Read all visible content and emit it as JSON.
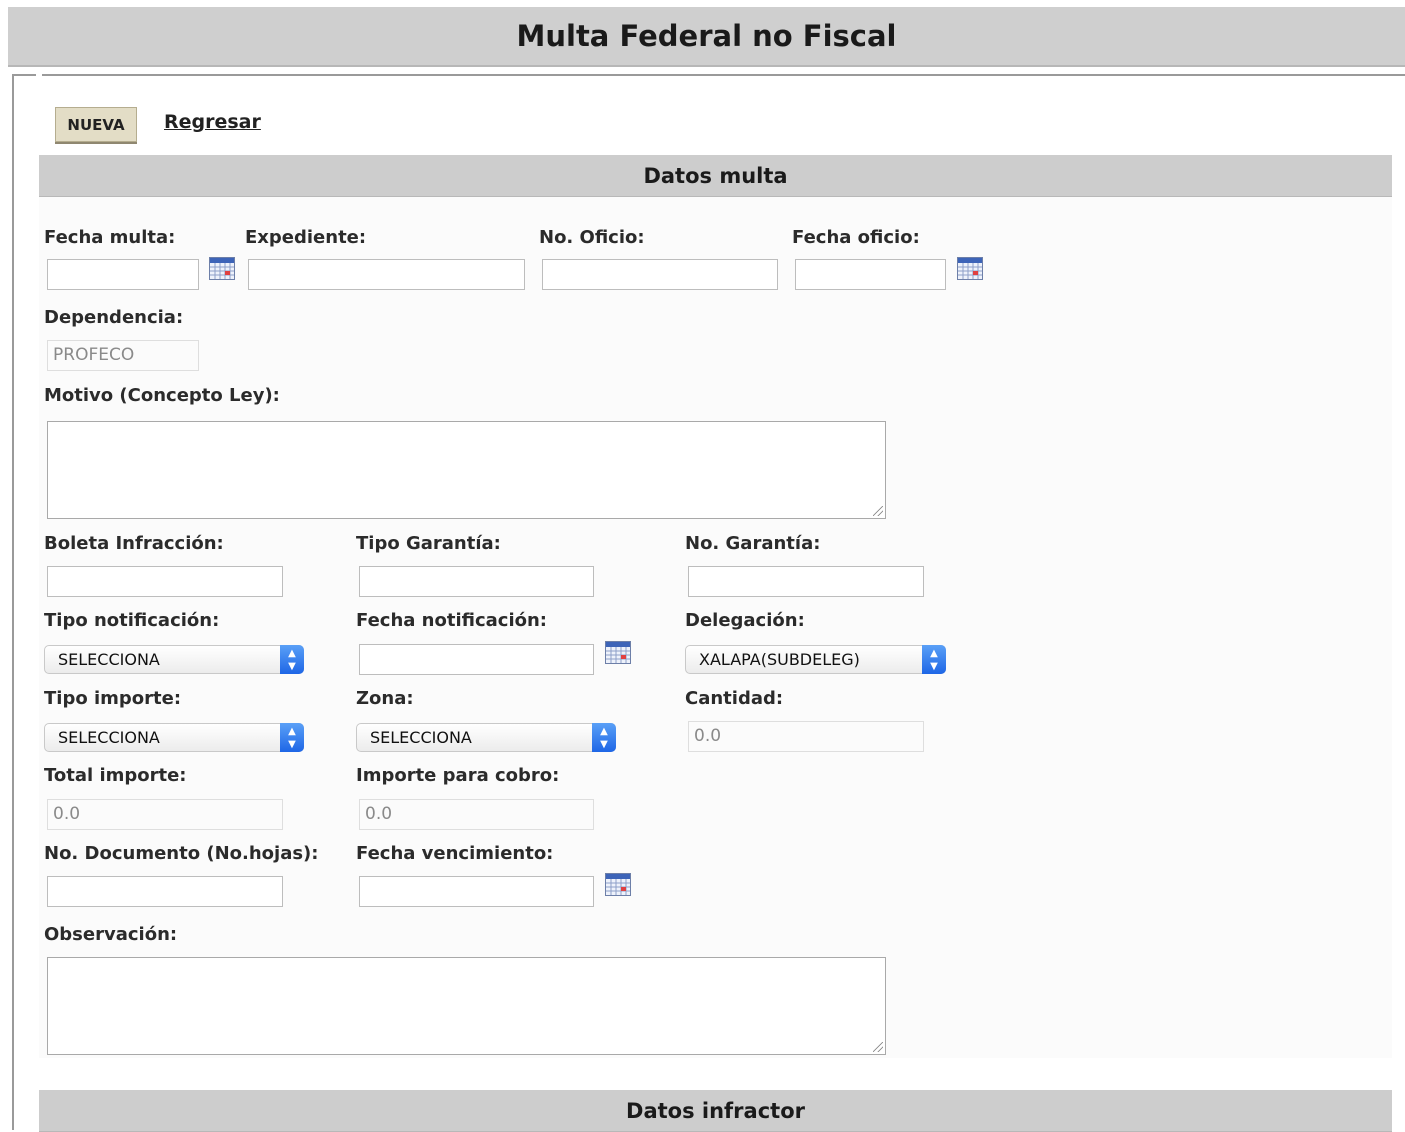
{
  "page": {
    "title": "Multa Federal no Fiscal"
  },
  "toolbar": {
    "nueva_label": "NUEVA",
    "regresar_label": "Regresar"
  },
  "sections": {
    "datos_multa": "Datos multa",
    "datos_infractor": "Datos infractor"
  },
  "fields": {
    "fecha_multa": {
      "label": "Fecha multa:",
      "value": ""
    },
    "expediente": {
      "label": "Expediente:",
      "value": ""
    },
    "no_oficio": {
      "label": "No. Oficio:",
      "value": ""
    },
    "fecha_oficio": {
      "label": "Fecha oficio:",
      "value": ""
    },
    "dependencia": {
      "label": "Dependencia:",
      "value": "PROFECO"
    },
    "motivo": {
      "label": "Motivo (Concepto Ley):",
      "value": ""
    },
    "boleta_infraccion": {
      "label": "Boleta Infracción:",
      "value": ""
    },
    "tipo_garantia": {
      "label": "Tipo Garantía:",
      "value": ""
    },
    "no_garantia": {
      "label": "No. Garantía:",
      "value": ""
    },
    "tipo_notificacion": {
      "label": "Tipo notificación:",
      "value": "SELECCIONA"
    },
    "fecha_notificacion": {
      "label": "Fecha notificación:",
      "value": ""
    },
    "delegacion": {
      "label": "Delegación:",
      "value": "XALAPA(SUBDELEG)"
    },
    "tipo_importe": {
      "label": "Tipo importe:",
      "value": "SELECCIONA"
    },
    "zona": {
      "label": "Zona:",
      "value": "SELECCIONA"
    },
    "cantidad": {
      "label": "Cantidad:",
      "value": "0.0"
    },
    "total_importe": {
      "label": "Total importe:",
      "value": "0.0"
    },
    "importe_cobro": {
      "label": "Importe para cobro:",
      "value": "0.0"
    },
    "no_documento": {
      "label": "No. Documento (No.hojas):",
      "value": ""
    },
    "fecha_vencimiento": {
      "label": "Fecha vencimiento:",
      "value": ""
    },
    "observacion": {
      "label": "Observación:",
      "value": ""
    }
  },
  "icons": {
    "calendar": "calendar-icon",
    "select_arrow": "updown-chevron-icon"
  },
  "colors": {
    "header_bg": "#cfcfcf",
    "button_bg": "#e3ddc6",
    "select_accent": "#2f78ef"
  }
}
